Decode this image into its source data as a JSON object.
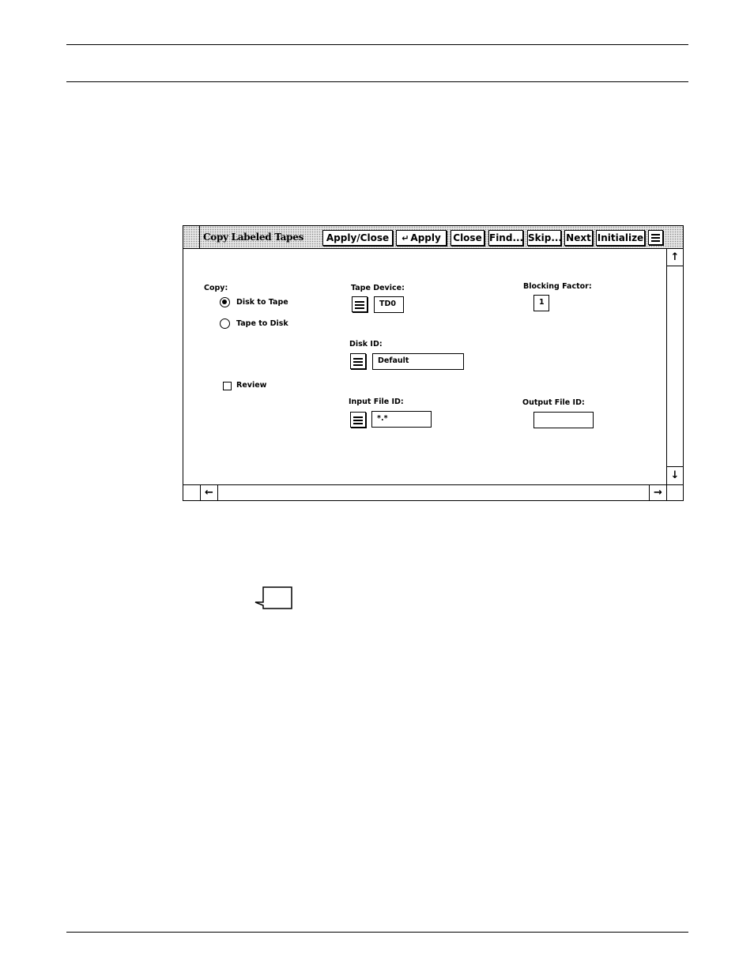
{
  "window": {
    "title": "Copy Labeled Tapes",
    "buttons": {
      "apply_close": "Apply/Close",
      "apply": "Apply",
      "close": "Close",
      "find": "Find...",
      "skip": "Skip...",
      "next": "Next",
      "initialize": "Initialize"
    }
  },
  "form": {
    "copy": {
      "label": "Copy:",
      "options": [
        "Disk to Tape",
        "Tape to Disk"
      ],
      "selected": "Disk to Tape"
    },
    "review": {
      "label": "Review",
      "checked": false
    },
    "tape_device": {
      "label": "Tape Device:",
      "value": "TD0"
    },
    "blocking_factor": {
      "label": "Blocking Factor:",
      "value": "1"
    },
    "disk_id": {
      "label": "Disk ID:",
      "value": "Default"
    },
    "input_file_id": {
      "label": "Input File ID:",
      "value": "*.*"
    },
    "output_file_id": {
      "label": "Output File ID:",
      "value": ""
    }
  },
  "icons": {
    "menu": "menu-lines-icon",
    "scroll_up": "arrow-up-icon",
    "scroll_down": "arrow-down-icon",
    "scroll_left": "arrow-left-icon",
    "scroll_right": "arrow-right-icon",
    "return": "return-arrow-icon",
    "note": "note-page-icon"
  }
}
